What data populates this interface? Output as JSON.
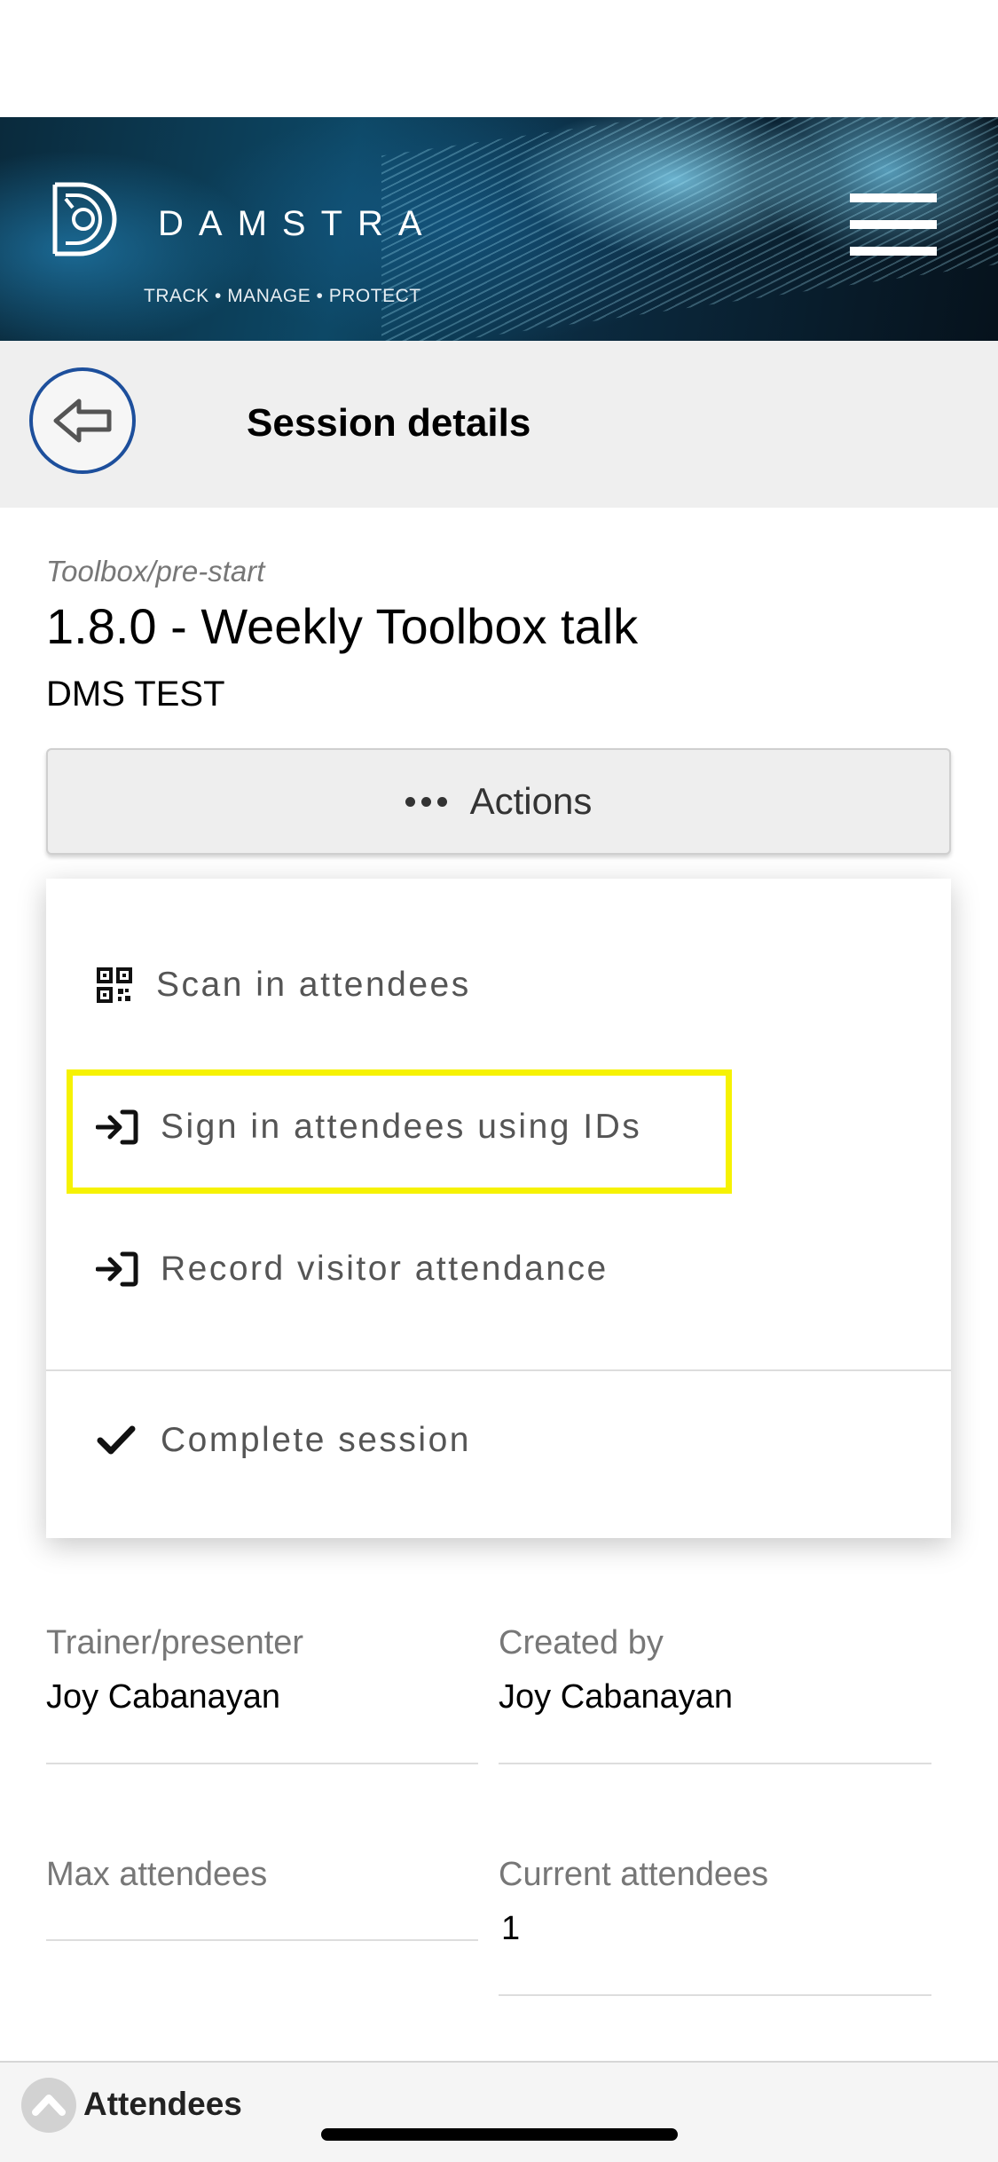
{
  "brand": {
    "name": "DAMSTRA",
    "tagline": "TRACK • MANAGE • PROTECT"
  },
  "header": {
    "title": "Session details"
  },
  "session": {
    "category": "Toolbox/pre-start",
    "title": "1.8.0 - Weekly Toolbox talk",
    "organization": "DMS TEST"
  },
  "actions": {
    "label": "Actions",
    "menu_items": [
      {
        "label": "Scan in attendees",
        "icon": "qr-code-icon"
      },
      {
        "label": "Sign in attendees using IDs",
        "icon": "sign-in-icon",
        "highlighted": true
      },
      {
        "label": "Record visitor attendance",
        "icon": "sign-in-icon"
      },
      {
        "label": "Complete session",
        "icon": "checkmark-icon"
      }
    ]
  },
  "fields": {
    "trainer": {
      "label": "Trainer/presenter",
      "value": "Joy Cabanayan"
    },
    "created_by": {
      "label": "Created by",
      "value": "Joy Cabanayan"
    },
    "max_attendees": {
      "label": "Max attendees",
      "value": ""
    },
    "current_attendees": {
      "label": "Current attendees",
      "value": "1"
    }
  },
  "bottom_panel": {
    "label": "Attendees"
  },
  "colors": {
    "back_button_border": "#1d4f9c",
    "highlight": "#f6f203",
    "header_bg": "#efefef"
  }
}
